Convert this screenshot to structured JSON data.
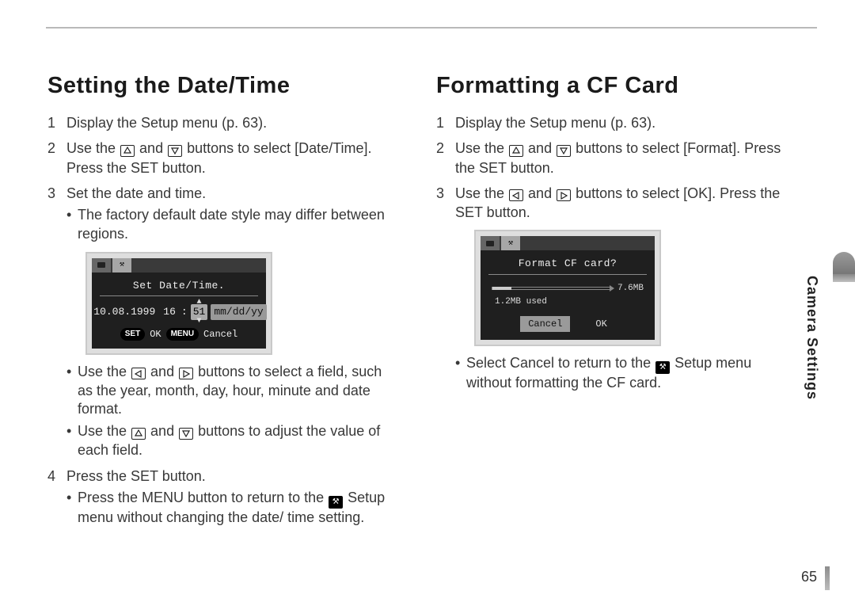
{
  "page_number": "65",
  "side_tab_label": "Camera Settings",
  "left": {
    "heading": "Setting the Date/Time",
    "step1": "Display the Setup menu (p. 63).",
    "step2_a": "Use the ",
    "step2_b": " and ",
    "step2_c": " buttons to select [Date/Time]. Press the SET button.",
    "step3": "Set the date and time.",
    "step3_note": "The factory default date style may differ between regions.",
    "lcd": {
      "title": "Set Date/Time.",
      "date": "10.08.1999",
      "hour": "16",
      "minute": "51",
      "format": "mm/dd/yy",
      "footer_set": "SET",
      "footer_ok": "OK",
      "footer_menu": "MENU",
      "footer_cancel": "Cancel"
    },
    "post_a_1": "Use the ",
    "post_a_2": " and ",
    "post_a_3": " buttons to select a field, such as the year, month, day, hour, minute and date format.",
    "post_b_1": "Use the ",
    "post_b_2": " and ",
    "post_b_3": " buttons to adjust the value of each field.",
    "step4": "Press the SET button.",
    "step4_note_1": "Press the MENU button to return to the ",
    "step4_note_2": " Setup menu without changing the date/ time setting."
  },
  "right": {
    "heading": "Formatting a CF Card",
    "step1": "Display the Setup menu (p. 63).",
    "step2_a": "Use the ",
    "step2_b": " and ",
    "step2_c": " buttons to select [Format]. Press the SET button.",
    "step3_a": "Use the ",
    "step3_b": " and ",
    "step3_c": " buttons to select [OK]. Press the SET button.",
    "lcd": {
      "title": "Format CF card?",
      "total": "7.6MB",
      "used": "1.2MB used",
      "cancel": "Cancel",
      "ok": "OK"
    },
    "post_1": "Select Cancel to return to the ",
    "post_2": " Setup menu without formatting the CF card."
  }
}
